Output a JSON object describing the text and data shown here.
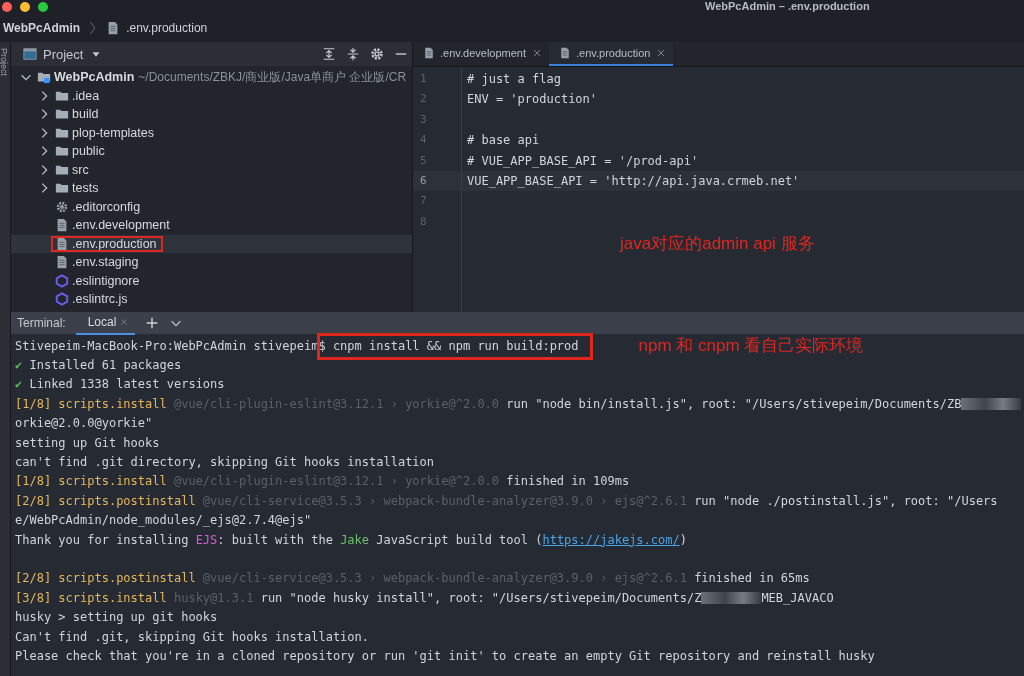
{
  "window": {
    "title": "WebPcAdmin – .env.production"
  },
  "breadcrumb": [
    {
      "label": "WebPcAdmin",
      "kind": "project"
    },
    {
      "label": ".env.production",
      "kind": "file"
    }
  ],
  "side_strip": {
    "label": "Project"
  },
  "project_panel": {
    "title": "Project",
    "tree": [
      {
        "label": "WebPcAdmin",
        "path": "~/Documents/ZBKJ/商业版/Java单商户 企业版/CR",
        "kind": "root",
        "expanded": true,
        "selected": false,
        "annotated": false,
        "children": [
          {
            "label": ".idea",
            "kind": "folder",
            "expanded": false,
            "selected": false,
            "annotated": false
          },
          {
            "label": "build",
            "kind": "folder",
            "expanded": false,
            "selected": false,
            "annotated": false
          },
          {
            "label": "plop-templates",
            "kind": "folder",
            "expanded": false,
            "selected": false,
            "annotated": false
          },
          {
            "label": "public",
            "kind": "folder",
            "expanded": false,
            "selected": false,
            "annotated": false
          },
          {
            "label": "src",
            "kind": "folder",
            "expanded": false,
            "selected": false,
            "annotated": false
          },
          {
            "label": "tests",
            "kind": "folder",
            "expanded": false,
            "selected": false,
            "annotated": false
          },
          {
            "label": ".editorconfig",
            "kind": "gear",
            "selected": false,
            "annotated": false
          },
          {
            "label": ".env.development",
            "kind": "file",
            "selected": false,
            "annotated": false
          },
          {
            "label": ".env.production",
            "kind": "file",
            "selected": true,
            "annotated": true
          },
          {
            "label": ".env.staging",
            "kind": "file",
            "selected": false,
            "annotated": false
          },
          {
            "label": ".eslintignore",
            "kind": "eslint",
            "selected": false,
            "annotated": false
          },
          {
            "label": ".eslintrc.js",
            "kind": "eslint",
            "selected": false,
            "annotated": false
          }
        ]
      }
    ]
  },
  "editor": {
    "tabs": [
      {
        "label": ".env.development",
        "selected": false
      },
      {
        "label": ".env.production",
        "selected": true
      }
    ],
    "lines": [
      {
        "number": "1",
        "text": "# just a flag",
        "current": false
      },
      {
        "number": "2",
        "text": "ENV = 'production'",
        "current": false
      },
      {
        "number": "3",
        "current": false
      },
      {
        "number": "4",
        "text": "# base api",
        "current": false
      },
      {
        "number": "5",
        "text": "# VUE_APP_BASE_API = '/prod-api'",
        "current": false
      },
      {
        "number": "6",
        "text": "VUE_APP_BASE_API = 'http://api.java.crmeb.net'",
        "current": true
      },
      {
        "number": "7",
        "current": false
      },
      {
        "number": "8",
        "current": false
      }
    ],
    "annotation": "java对应的admin api 服务"
  },
  "terminal": {
    "label": "Terminal:",
    "tabs": [
      {
        "label": "Local",
        "selected": true
      }
    ],
    "lines": [
      {
        "segments": [
          {
            "kind": "plain",
            "text": "Stivepeim-MacBook-Pro:WebPcAdmin stivepeim"
          },
          {
            "kind": "boxed",
            "text": "$ cnpm install && npm run build:prod"
          }
        ],
        "annotation": "npm 和 cnpm 看自己实际环境"
      },
      {
        "segments": [
          {
            "kind": "check",
            "text": "✔"
          },
          {
            "kind": "plain",
            "text": " Installed 61 packages"
          }
        ]
      },
      {
        "segments": [
          {
            "kind": "check",
            "text": "✔"
          },
          {
            "kind": "plain",
            "text": " Linked 1338 latest versions"
          }
        ]
      },
      {
        "segments": [
          {
            "kind": "step",
            "text": "[1/8] scripts.install "
          },
          {
            "kind": "dim",
            "text": "@vue/cli-plugin-eslint@3.12.1 › yorkie@^2.0.0"
          },
          {
            "kind": "plain",
            "text": " run \"node bin/install.js\", root: \"/Users/stivepeim/Documents/ZB"
          },
          {
            "kind": "blur"
          }
        ]
      },
      {
        "segments": [
          {
            "kind": "plain",
            "text": "orkie@2.0.0@yorkie\""
          }
        ]
      },
      {
        "segments": [
          {
            "kind": "plain",
            "text": "setting up Git hooks"
          }
        ]
      },
      {
        "segments": [
          {
            "kind": "plain",
            "text": "can't find .git directory, skipping Git hooks installation"
          }
        ]
      },
      {
        "segments": [
          {
            "kind": "step",
            "text": "[1/8] scripts.install "
          },
          {
            "kind": "dim",
            "text": "@vue/cli-plugin-eslint@3.12.1 › yorkie@^2.0.0"
          },
          {
            "kind": "plain",
            "text": " finished in 109ms"
          }
        ]
      },
      {
        "segments": [
          {
            "kind": "step",
            "text": "[2/8] scripts.postinstall "
          },
          {
            "kind": "dim",
            "text": "@vue/cli-service@3.5.3 › webpack-bundle-analyzer@3.9.0 › ejs@^2.6.1"
          },
          {
            "kind": "plain",
            "text": " run \"node ./postinstall.js\", root: \"/Users"
          }
        ]
      },
      {
        "segments": [
          {
            "kind": "plain",
            "text": "e/WebPcAdmin/node_modules/_ejs@2.7.4@ejs\""
          }
        ]
      },
      {
        "segments": [
          {
            "kind": "plain",
            "text": "Thank you for installing "
          },
          {
            "kind": "magenta",
            "text": "EJS"
          },
          {
            "kind": "plain",
            "text": ": built with the "
          },
          {
            "kind": "green",
            "text": "Jake"
          },
          {
            "kind": "plain",
            "text": " JavaScript build tool ("
          },
          {
            "kind": "link",
            "text": "https://jakejs.com/"
          },
          {
            "kind": "plain",
            "text": ")"
          }
        ],
        "gap_after": true
      },
      {
        "segments": [
          {
            "kind": "step",
            "text": "[2/8] scripts.postinstall "
          },
          {
            "kind": "dim",
            "text": "@vue/cli-service@3.5.3 › webpack-bundle-analyzer@3.9.0 › ejs@^2.6.1"
          },
          {
            "kind": "plain",
            "text": " finished in 65ms"
          }
        ]
      },
      {
        "segments": [
          {
            "kind": "step",
            "text": "[3/8] scripts.install "
          },
          {
            "kind": "dim",
            "text": "husky@1.3.1"
          },
          {
            "kind": "plain",
            "text": " run \"node husky install\", root: \"/Users/stivepeim/Documents/Z"
          },
          {
            "kind": "blur"
          },
          {
            "kind": "plain",
            "text": "MEB_JAVACO"
          }
        ]
      },
      {
        "segments": [
          {
            "kind": "plain",
            "text": "husky > setting up git hooks"
          }
        ]
      },
      {
        "segments": [
          {
            "kind": "plain",
            "text": "Can't find .git, skipping Git hooks installation."
          }
        ]
      },
      {
        "segments": [
          {
            "kind": "plain",
            "text": "Please check that you're in a cloned repository or run 'git init' to create an empty Git repository and reinstall husky"
          }
        ]
      }
    ]
  }
}
